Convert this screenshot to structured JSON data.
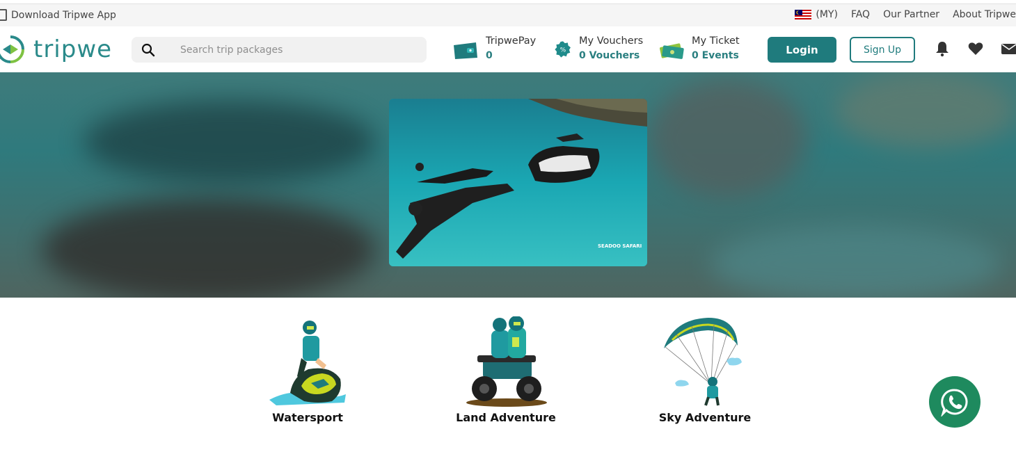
{
  "topbar": {
    "download_app": "Download Tripwe App",
    "locale": "(MY)",
    "links": [
      "FAQ",
      "Our Partner",
      "About Tripwe"
    ]
  },
  "header": {
    "logo": "tripwe",
    "search_placeholder": "Search trip packages",
    "tripwepay": {
      "label": "TripwePay",
      "value": "0"
    },
    "vouchers": {
      "label": "My Vouchers",
      "value": "0 Vouchers"
    },
    "tickets": {
      "label": "My Ticket",
      "value": "0 Events"
    },
    "login": "Login",
    "signup": "Sign Up",
    "icons": [
      "bell-icon",
      "heart-icon",
      "mail-icon"
    ]
  },
  "hero": {
    "image_watermark": "SEADOO SAFARI"
  },
  "categories": [
    {
      "label": "Watersport",
      "icon": "jetski-illustration"
    },
    {
      "label": "Land Adventure",
      "icon": "atv-illustration"
    },
    {
      "label": "Sky Adventure",
      "icon": "paraglider-illustration"
    }
  ],
  "colors": {
    "brand": "#1f7b7d",
    "accent_text": "#2a7f80",
    "whatsapp": "#1e8a5e"
  }
}
